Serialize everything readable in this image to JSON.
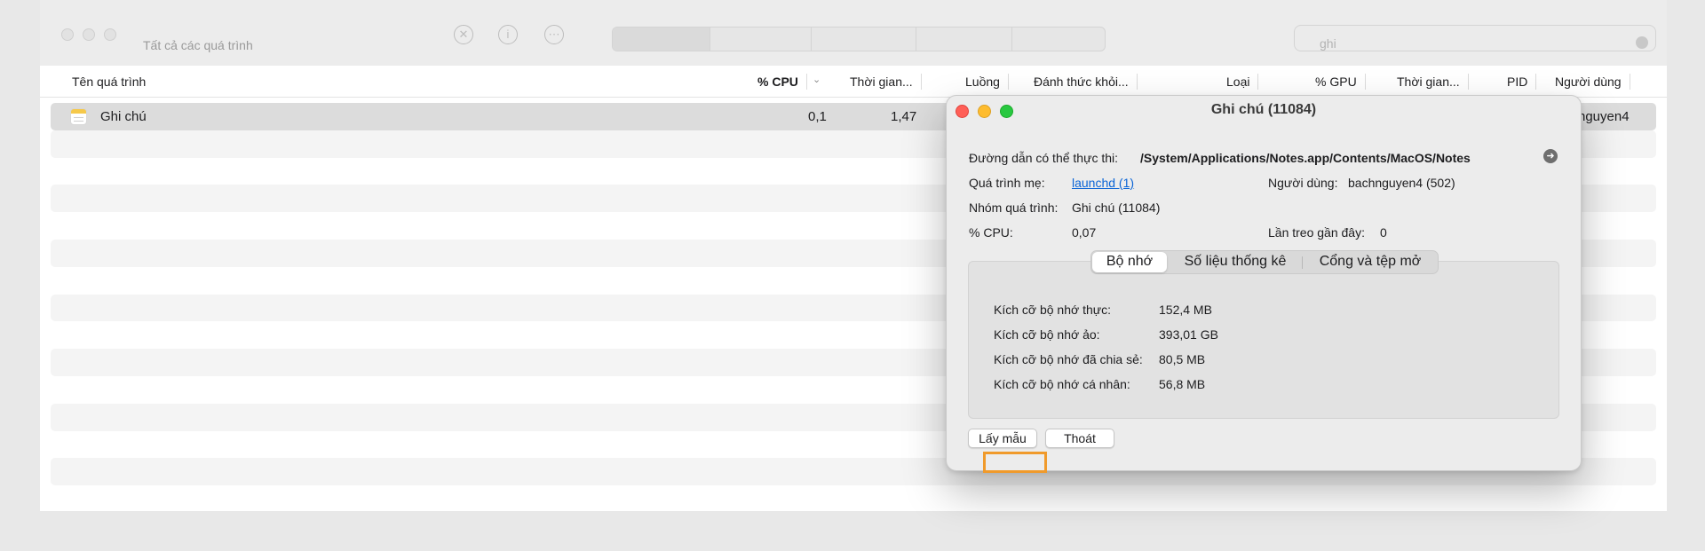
{
  "window": {
    "subtitle": "Tất cả các quá trình",
    "search_value": "ghi"
  },
  "table": {
    "columns": [
      "Tên quá trình",
      "% CPU",
      "Thời gian...",
      "Luồng",
      "Đánh thức khỏi...",
      "Loại",
      "% GPU",
      "Thời gian...",
      "PID",
      "Người dùng"
    ],
    "sorted_column": "% CPU",
    "selected_row": {
      "name": "Ghi chú",
      "cpu": "0,1",
      "cpu_time": "1,47",
      "user": "nguyen4"
    }
  },
  "dialog": {
    "title": "Ghi chú (11084)",
    "executable_path_label": "Đường dẫn có thể thực thi:",
    "executable_path_value": "/System/Applications/Notes.app/Contents/MacOS/Notes",
    "parent_label": "Quá trình mẹ:",
    "parent_value": "launchd (1)",
    "user_label": "Người dùng:",
    "user_value": "bachnguyen4 (502)",
    "group_label": "Nhóm quá trình:",
    "group_value": "Ghi chú (11084)",
    "cpu_label": "% CPU:",
    "cpu_value": "0,07",
    "hangs_label": "Lần treo gần đây:",
    "hangs_value": "0",
    "tabs": [
      "Bộ nhớ",
      "Số liệu thống kê",
      "Cổng và tệp mở"
    ],
    "active_tab": "Bộ nhớ",
    "memory": [
      {
        "label": "Kích cỡ bộ nhớ thực:",
        "value": "152,4 MB"
      },
      {
        "label": "Kích cỡ bộ nhớ ảo:",
        "value": "393,01 GB"
      },
      {
        "label": "Kích cỡ bộ nhớ đã chia sẻ:",
        "value": "80,5 MB"
      },
      {
        "label": "Kích cỡ bộ nhớ cá nhân:",
        "value": "56,8 MB"
      }
    ],
    "sample_button": "Lấy mẫu",
    "quit_button": "Thoát"
  },
  "colors": {
    "highlight": "#f09a2b",
    "link": "#0a64d6",
    "close": "#ff5f57",
    "minimize": "#febc2e",
    "zoom": "#28c840"
  }
}
